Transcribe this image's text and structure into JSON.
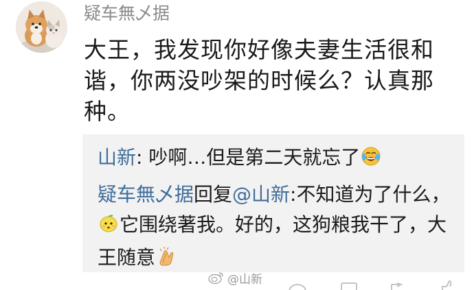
{
  "comment": {
    "username": "疑车無乄据",
    "text": "大王，我发现你好像夫妻生活很和谐，你两没吵架的时候么？认真那种。",
    "avatar": "shiba-and-cat-avatar"
  },
  "replies": [
    {
      "author": "山新",
      "separator": ":",
      "text_before_emoji": " 吵啊…但是第二天就忘了",
      "emoji": "laugh-cry-emoji"
    },
    {
      "author": "疑车無乄据",
      "reply_word": "回复",
      "mention": "@山新",
      "separator": ":",
      "text_part1": "不知道为了什么，",
      "emoji1": "lemon-emoji",
      "text_part2": "它围绕著我。好的，这狗粮我干了，大王随意",
      "emoji2": "clap-emoji"
    }
  ],
  "footer": {
    "time_partial": "",
    "watermark": "@山新",
    "watermark_icon": "weibo-icon",
    "action_icons": [
      "share-icon",
      "comment-icon",
      "like-icon"
    ]
  },
  "colors": {
    "link": "#3f6d9a",
    "username": "#8a8a8a",
    "text": "#1a1a1a",
    "reply_bg": "#f2f2f2"
  }
}
